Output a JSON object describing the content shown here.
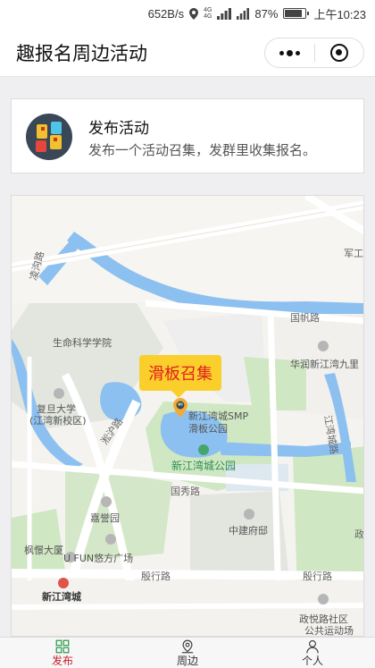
{
  "statusbar": {
    "net_speed": "652B/s",
    "net_small_top": "4G",
    "net_small_bottom": "4G",
    "battery_text": "87%",
    "battery_level": 0.87,
    "time": "上午10:23"
  },
  "navbar": {
    "title": "趣报名周边活动",
    "more_icon": "more-dots-icon",
    "close_icon": "miniprogram-close-icon"
  },
  "publish_card": {
    "title": "发布活动",
    "subtitle": "发布一个活动召集，发群里收集报名。"
  },
  "map": {
    "callout": "滑板召集",
    "poi": {
      "skatepark_line1": "新江湾城SMP",
      "skatepark_line2": "滑板公园",
      "park": "新江湾城公园",
      "life_science": "生命科学学院",
      "fudan_line1": "复旦大学",
      "fudan_line2": "(江湾新校区)",
      "huarun": "华润新江湾九里",
      "jiayu": "嘉誉园",
      "zhongjian": "中建府邸",
      "fengjing": "枫憬大厦",
      "ufun": "U FUN悠方广场",
      "metro": "新江湾城",
      "zhengli_line1": "政悦路社区",
      "zhengli_line2": "公共运动场"
    },
    "roads": {
      "lingchang": "凌沟路",
      "guofan": "国帆路",
      "guoxiu": "国秀路",
      "yinxing": "殷行路",
      "yinxing2": "殷行路",
      "songhu": "淞沪路",
      "jiangwan": "江湾城路",
      "jungong": "军工",
      "right_edge": "政"
    }
  },
  "tabs": [
    {
      "label": "发布",
      "icon": "grid-icon",
      "active": true
    },
    {
      "label": "周边",
      "icon": "location-pin-icon",
      "active": false
    },
    {
      "label": "个人",
      "icon": "person-icon",
      "active": false
    }
  ],
  "colors": {
    "accent_red": "#c8202e",
    "callout_bg": "#fbcf2b",
    "water": "#8cc0f0",
    "park": "#cfe7c2"
  }
}
